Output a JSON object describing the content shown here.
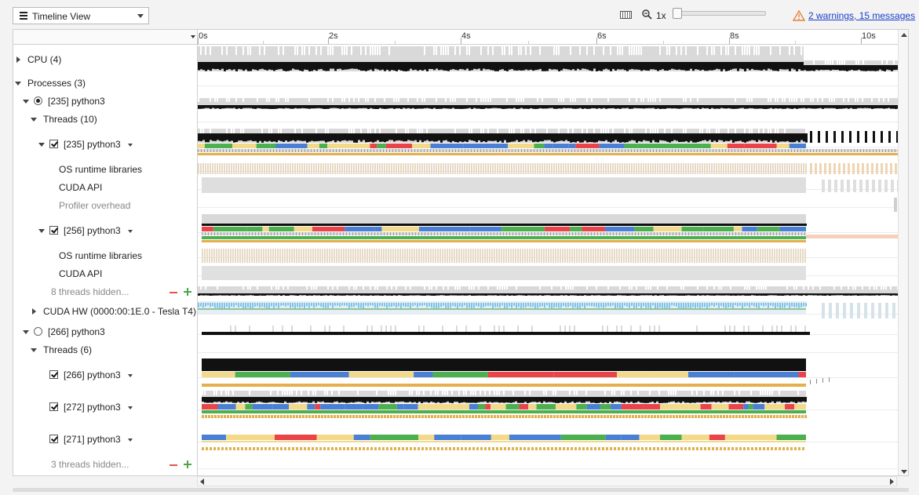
{
  "toolbar": {
    "view_label": "Timeline View",
    "zoom_label": "1x",
    "warnings_link": "2 warnings, 15 messages",
    "icons": {
      "menu": "hamburger-icon",
      "keyboard": "keyboard-icon",
      "zoom": "magnifier-icon",
      "warning": "warning-triangle-icon"
    }
  },
  "ruler": {
    "ticks": [
      "0s",
      "2s",
      "4s",
      "6s",
      "8s",
      "10s"
    ]
  },
  "tree": {
    "cpu": "CPU (4)",
    "processes": "Processes (3)",
    "p235": "[235] python3",
    "p235_threads": "Threads (10)",
    "t235": "[235] python3",
    "t235_os": "OS runtime libraries",
    "t235_cuda": "CUDA API",
    "t235_prof": "Profiler overhead",
    "t256": "[256] python3",
    "t256_os": "OS runtime libraries",
    "t256_cuda": "CUDA API",
    "hidden8": "8 threads hidden...",
    "cudahw": "CUDA HW (0000:00:1E.0 - Tesla T4)",
    "p266": "[266] python3",
    "p266_threads": "Threads (6)",
    "t266": "[266] python3",
    "t272": "[272] python3",
    "t271": "[271] python3",
    "hidden3": "3 threads hidden..."
  },
  "colors": {
    "red": "#e8444a",
    "green": "#4caf50",
    "blue": "#4a7fd4",
    "yellow": "#f3d98a",
    "orange": "#e2b04c",
    "gray": "#d9d9d9",
    "black": "#111111",
    "cyan": "#7fc4e8",
    "salmon": "#f7d0bd",
    "warning": "#e8803a",
    "link": "#1a3ec8"
  }
}
